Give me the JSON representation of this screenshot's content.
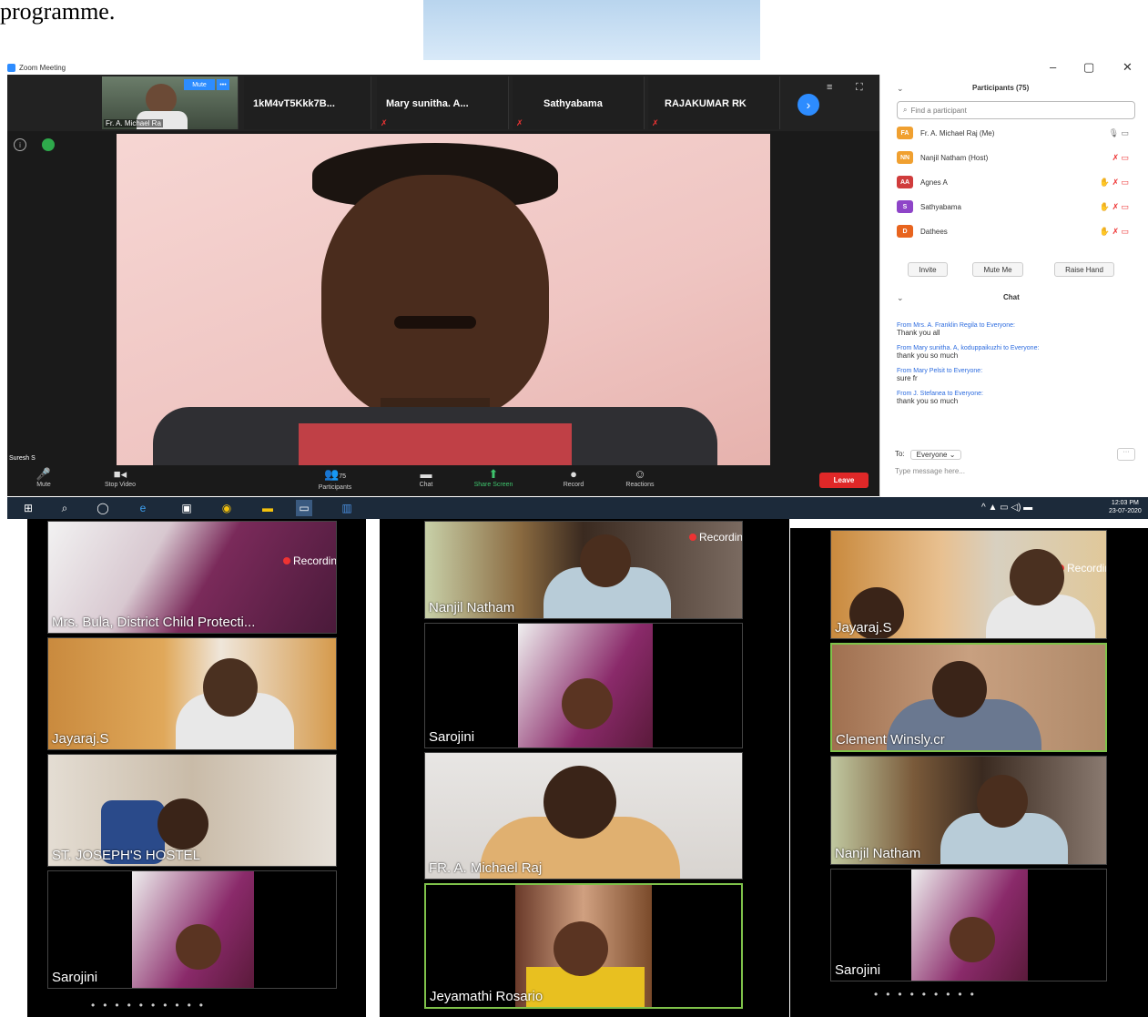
{
  "document": {
    "intro_text": "programme."
  },
  "zoom": {
    "window_title": "Zoom Meeting",
    "thumbnails": [
      {
        "name": "Fr. A. Michael Ra",
        "mute_label": "Mute"
      },
      {
        "name": "1kM4vT5Kkk7B..."
      },
      {
        "name": "Mary sunitha. A..."
      },
      {
        "name": "Sathyabama"
      },
      {
        "name": "RAJAKUMAR RK"
      }
    ],
    "speaker_name": "Suresh S",
    "toolbar": {
      "mute": "Mute",
      "stop_video": "Stop Video",
      "participants": "Participants",
      "participants_count": "75",
      "chat": "Chat",
      "share_screen": "Share Screen",
      "record": "Record",
      "reactions": "Reactions",
      "leave": "Leave"
    },
    "participants_panel": {
      "title": "Participants (75)",
      "search_placeholder": "Find a participant",
      "rows": [
        {
          "initials": "FA",
          "name": "Fr. A. Michael Raj (Me)",
          "color": "#f0a030"
        },
        {
          "initials": "NN",
          "name": "Nanjil Natham (Host)",
          "color": "#f0a030"
        },
        {
          "initials": "AA",
          "name": "Agnes A",
          "color": "#d03c3c"
        },
        {
          "initials": "S",
          "name": "Sathyabama",
          "color": "#8e44c8"
        },
        {
          "initials": "D",
          "name": "Dathees",
          "color": "#e8641e"
        }
      ],
      "invite": "Invite",
      "mute_me": "Mute Me",
      "raise_hand": "Raise Hand"
    },
    "chat_panel": {
      "title": "Chat",
      "messages": [
        {
          "from": "From Mrs. A. Franklin Regila to Everyone:",
          "text": "Thank you all"
        },
        {
          "from": "From Mary sunitha. A, koduppaikuzhi to Everyone:",
          "text": "thank you so much"
        },
        {
          "from": "From Mary Pelsit to Everyone:",
          "text": "sure fr"
        },
        {
          "from": "From J. Stefanea to Everyone:",
          "text": "thank you so much"
        }
      ],
      "to_label": "To:",
      "to_value": "Everyone",
      "input_placeholder": "Type message here..."
    },
    "taskbar": {
      "time": "12:03 PM",
      "date": "23-07-2020"
    }
  },
  "gallery": {
    "recording_label": "Recording",
    "columns": [
      {
        "tiles": [
          "Mrs. Bula, District Child Protecti...",
          "Jayaraj.S",
          "ST. JOSEPH'S HOSTEL",
          "Sarojini"
        ]
      },
      {
        "tiles": [
          "Nanjil Natham",
          "Sarojini",
          "FR. A. Michael Raj",
          "Jeyamathi Rosario"
        ]
      },
      {
        "tiles": [
          "Jayaraj.S",
          "Clement Winsly.cr",
          "Nanjil Natham",
          "Sarojini"
        ]
      }
    ]
  }
}
